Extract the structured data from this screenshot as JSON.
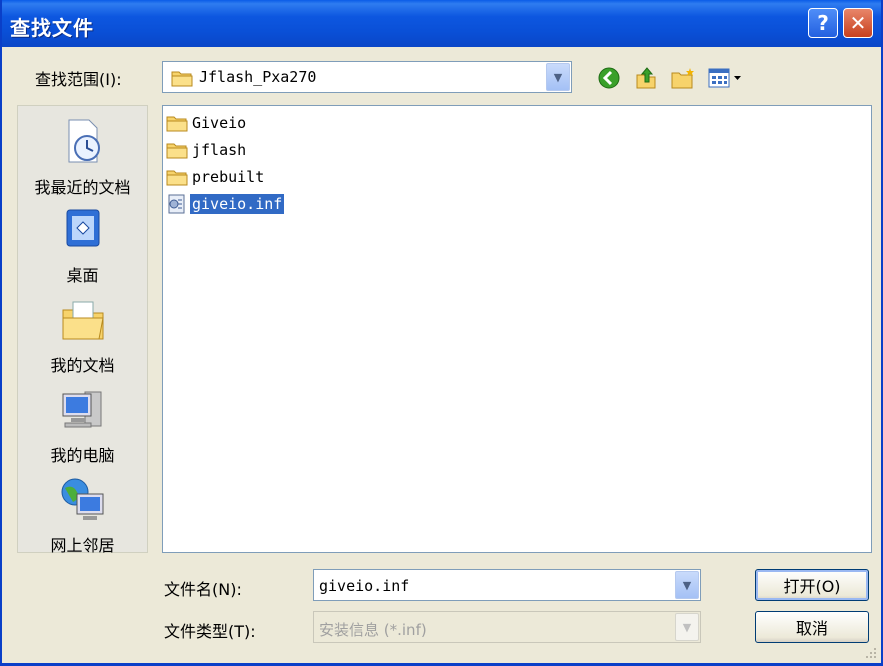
{
  "window": {
    "title": "查找文件",
    "help_glyph": "?",
    "close_glyph": "✕"
  },
  "lookin": {
    "label": "查找范围(I):",
    "value": "Jflash_Pxa270"
  },
  "places": [
    {
      "label": "我最近的文档",
      "icon": "recent-documents-icon"
    },
    {
      "label": "桌面",
      "icon": "desktop-icon"
    },
    {
      "label": "我的文档",
      "icon": "my-documents-icon"
    },
    {
      "label": "我的电脑",
      "icon": "my-computer-icon"
    },
    {
      "label": "网上邻居",
      "icon": "network-places-icon"
    }
  ],
  "files": [
    {
      "name": "Giveio",
      "type": "folder"
    },
    {
      "name": "jflash",
      "type": "folder"
    },
    {
      "name": "prebuilt",
      "type": "folder"
    },
    {
      "name": "giveio.inf",
      "type": "setup-file",
      "selected": true
    }
  ],
  "filename": {
    "label": "文件名(N):",
    "value": "giveio.inf"
  },
  "filetype": {
    "label": "文件类型(T):",
    "value": "安装信息 (*.inf)"
  },
  "buttons": {
    "open": "打开(O)",
    "cancel": "取消"
  },
  "colors": {
    "title_blue": "#0a4fd6",
    "selection": "#316ac5",
    "dialog_bg": "#ece9d8"
  }
}
